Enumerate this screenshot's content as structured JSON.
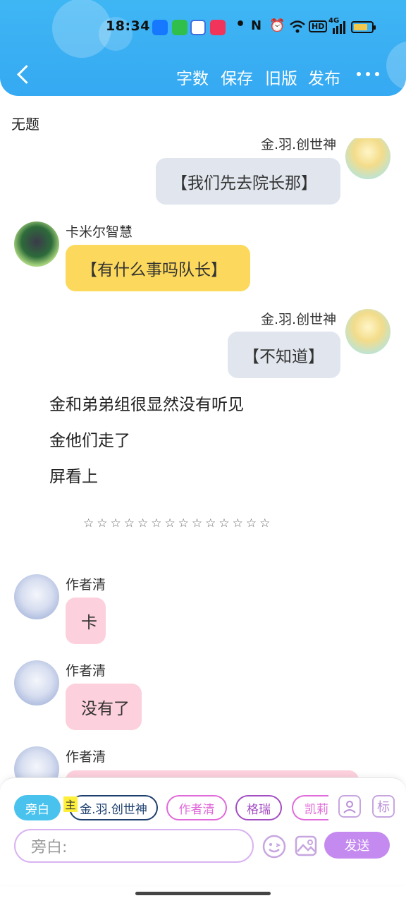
{
  "status_bar": {
    "time": "18:34",
    "icons": [
      "alipay-icon",
      "wechat-store-icon",
      "app-icon",
      "video-app-icon",
      "dot-icon",
      "nfc-icon",
      "alarm-icon",
      "wifi-icon",
      "hd-icon",
      "signal-icon",
      "battery-icon"
    ],
    "hd_label": "HD",
    "network_label": "4G",
    "battery_level": 0.8
  },
  "toolbar": {
    "back_icon": "chevron-left-icon",
    "word_count_label": "字数",
    "save_label": "保存",
    "old_version_label": "旧版",
    "publish_label": "发布",
    "more_icon": "more-dots-icon"
  },
  "document": {
    "title": "无题"
  },
  "chat": {
    "partial_name": "金.羽.创世神",
    "msg1_text": "【我们先去院长那】",
    "msg2_name": "卡米尔智慧",
    "msg2_text": "【有什么事吗队长】",
    "msg3_name": "金.羽.创世神",
    "msg3_text": "【不知道】",
    "narration": [
      "金和弟弟组很显然没有听见",
      "金他们走了",
      "屏看上"
    ],
    "divider": "☆☆☆☆☆☆☆☆☆☆☆☆☆☆",
    "msg4_name": "作者清",
    "msg4_text": "卡",
    "msg5_name": "作者清",
    "msg5_text": "没有了",
    "msg6_name": "作者清"
  },
  "composer": {
    "aside_chip": "旁白",
    "main_tag": "主",
    "characters": [
      "金.羽.创世神",
      "作者清",
      "格瑞",
      "凯莉"
    ],
    "character_icon": "character-icon",
    "mark_label": "标",
    "input_placeholder": "旁白:",
    "emoji_icon": "emoji-icon",
    "image_icon": "image-icon",
    "send_label": "发送"
  },
  "colors": {
    "header_blue": "#3fb6f4",
    "bubble_gray": "#e1e6ee",
    "bubble_yellow": "#fcd95c",
    "bubble_pink": "#fcd0dc",
    "send_purple": "#c48af0"
  }
}
